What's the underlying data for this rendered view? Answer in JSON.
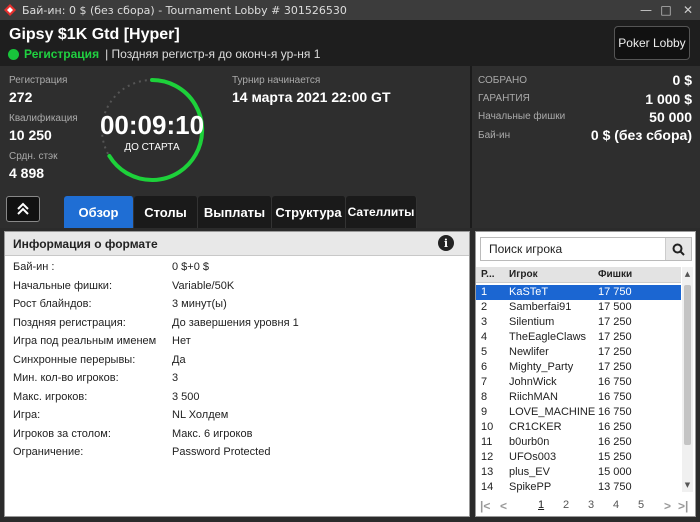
{
  "window": {
    "title": "Бай-ин: 0 $ (без сбора) - Tournament Lobby # 301526530",
    "minimize": "—",
    "maximize": "□",
    "close": "✕"
  },
  "header": {
    "tournament_name": "Gipsy $1K Gtd [Hyper]",
    "status": "Регистрация",
    "status_info": "| Поздняя регистр-я до оконч-я ур-ня 1",
    "lobby_button": "Poker Lobby"
  },
  "stats": {
    "registration_label": "Регистрация",
    "registration_value": "272",
    "qualification_label": "Квалификация",
    "qualification_value": "10 250",
    "avg_stack_label": "Срдн. стэк",
    "avg_stack_value": "4 898",
    "timer": "00:09:10",
    "timer_caption": "ДО СТАРТА",
    "start_label": "Турнир начинается",
    "start_value": "14 марта 2021   22:00 GT",
    "collected_label": "СОБРАНО",
    "collected_value": "0 $",
    "guarantee_label": "ГАРАНТИЯ",
    "guarantee_value": "1 000 $",
    "start_chips_label": "Начальные фишки",
    "start_chips_value": "50 000",
    "buyin_label": "Бай-ин",
    "buyin_value": "0 $ (без сбора)"
  },
  "tabs": [
    "Обзор",
    "Столы",
    "Выплаты",
    "Структура",
    "Сателлиты"
  ],
  "format": {
    "title": "Информация о формате",
    "rows": [
      {
        "k": "Бай-ин :",
        "v": "0 $+0 $"
      },
      {
        "k": "Начальные фишки:",
        "v": "Variable/50K"
      },
      {
        "k": "Рост блайндов:",
        "v": "3 минут(ы)"
      },
      {
        "k": "Поздняя регистрация:",
        "v": "До завершения уровня 1"
      },
      {
        "k": "Игра под реальным именем",
        "v": "Нет"
      },
      {
        "k": "Синхронные перерывы:",
        "v": "Да"
      },
      {
        "k": "Мин. кол-во игроков:",
        "v": "3"
      },
      {
        "k": "Макс. игроков:",
        "v": "3 500"
      },
      {
        "k": "Игра:",
        "v": "NL Холдем"
      },
      {
        "k": "Игроков за столом:",
        "v": "Макс. 6 игроков"
      },
      {
        "k": "Ограничение:",
        "v": "Password Protected"
      }
    ]
  },
  "players": {
    "search_placeholder": "Поиск игрока",
    "columns": [
      "Р...",
      "Игрок",
      "Фишки"
    ],
    "rows": [
      {
        "rank": "1",
        "name": "KaSTeT",
        "chips": "17 750"
      },
      {
        "rank": "2",
        "name": "Samberfai91",
        "chips": "17 500"
      },
      {
        "rank": "3",
        "name": "Silentium",
        "chips": "17 250"
      },
      {
        "rank": "4",
        "name": "TheEagleClaws",
        "chips": "17 250"
      },
      {
        "rank": "5",
        "name": "Newlifer",
        "chips": "17 250"
      },
      {
        "rank": "6",
        "name": "Mighty_Party",
        "chips": "17 250"
      },
      {
        "rank": "7",
        "name": "JohnWick",
        "chips": "16 750"
      },
      {
        "rank": "8",
        "name": "RiichMAN",
        "chips": "16 750"
      },
      {
        "rank": "9",
        "name": "LOVE_MACHINE",
        "chips": "16 750"
      },
      {
        "rank": "10",
        "name": "CR1CKER",
        "chips": "16 250"
      },
      {
        "rank": "11",
        "name": "b0urb0n",
        "chips": "16 250"
      },
      {
        "rank": "12",
        "name": "UFOs003",
        "chips": "15 250"
      },
      {
        "rank": "13",
        "name": "plus_EV",
        "chips": "15 000"
      },
      {
        "rank": "14",
        "name": "SpikePP",
        "chips": "13 750"
      }
    ],
    "pages": [
      "1",
      "2",
      "3",
      "4",
      "5"
    ],
    "nav": {
      "first": "|<",
      "prev": "<",
      "next": ">",
      "last": ">|"
    }
  },
  "colors": {
    "accent": "#1f6ed4",
    "status_green": "#20d040",
    "selected_row": "#1b66d2"
  }
}
